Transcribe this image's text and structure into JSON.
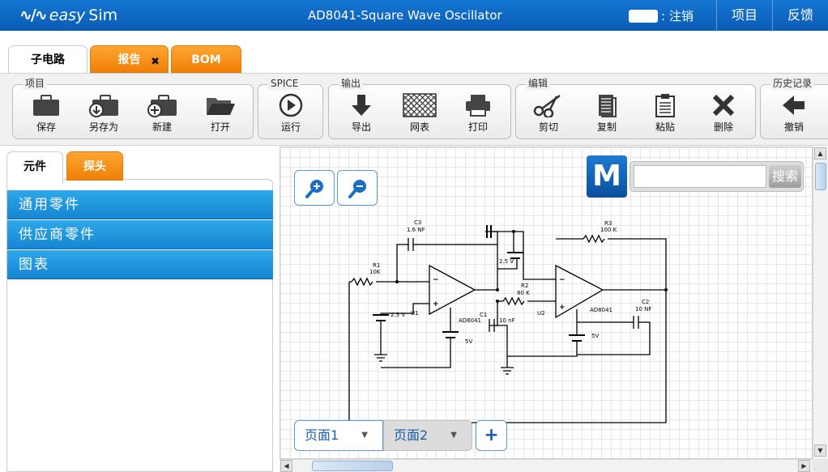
{
  "app": {
    "logo_text": "easy",
    "logo_text_strong": "Sim",
    "document_title": "AD8041-Square Wave Oscillator",
    "logout_label": ": 注销",
    "nav": [
      "项目",
      "反馈"
    ]
  },
  "main_tabs": {
    "subcircuit": "子电路",
    "report": "报告",
    "bom": "BOM",
    "close_glyph": "✖"
  },
  "toolbar": {
    "project": {
      "label": "项目",
      "save": "保存",
      "save_as": "另存为",
      "new": "新建",
      "open": "打开"
    },
    "spice": {
      "label": "SPICE",
      "run": "运行"
    },
    "output": {
      "label": "输出",
      "export": "导出",
      "netlist": "网表",
      "print": "打印"
    },
    "edit": {
      "label": "编辑",
      "cut": "剪切",
      "copy": "复制",
      "paste": "粘贴",
      "delete": "删除"
    },
    "history": {
      "label": "历史记录",
      "undo": "撤销"
    }
  },
  "left_panel": {
    "tabs": {
      "components": "元件",
      "probes": "探头"
    },
    "categories": [
      "通用零件",
      "供应商零件",
      "图表"
    ]
  },
  "canvas": {
    "search_placeholder": "",
    "search_button": "搜索",
    "mouser_logo": "M",
    "pages": [
      "页面1",
      "页面2"
    ],
    "add_page": "+"
  },
  "schematic": {
    "labels": {
      "c3_name": "C3",
      "c3_val": "1.6 NF",
      "r1_name": "R1",
      "r1_val": "10K",
      "r3_name": "R3",
      "r3_val": "100 K",
      "r2_name": "R2",
      "r2_val": "80 K",
      "c1_name": "C1",
      "c1_val": "10 nF",
      "c2_name": "C2",
      "c2_val": "10 NF",
      "u1": "U1",
      "u2": "U2",
      "ad8041_a": "AD8041",
      "ad8041_b": "AD8041",
      "v25_a": "2.5 V",
      "v25_b": "2.5 V",
      "v5_a": "5V",
      "v5_b": "5V"
    }
  }
}
